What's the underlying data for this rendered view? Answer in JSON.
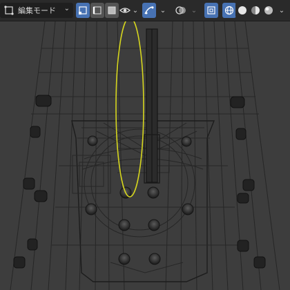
{
  "header": {
    "mode_dropdown": {
      "label": "編集モード",
      "icon": "mesh-edit-icon"
    },
    "select_modes": [
      "vertex-select-icon",
      "edge-select-icon",
      "face-select-icon"
    ],
    "toolbar_icons": [
      "viewport-visibility-icon",
      "proportional-edit-icon",
      "overlay-icon",
      "xray-icon",
      "shading-wireframe-icon",
      "shading-solid-icon",
      "shading-material-icon",
      "shading-rendered-icon"
    ]
  },
  "colors": {
    "background": "#3d3d3d",
    "header": "#2a2a2a",
    "active_button": "#4772b3",
    "wire": "#1e1e1e",
    "selection": "#d6d61e"
  }
}
